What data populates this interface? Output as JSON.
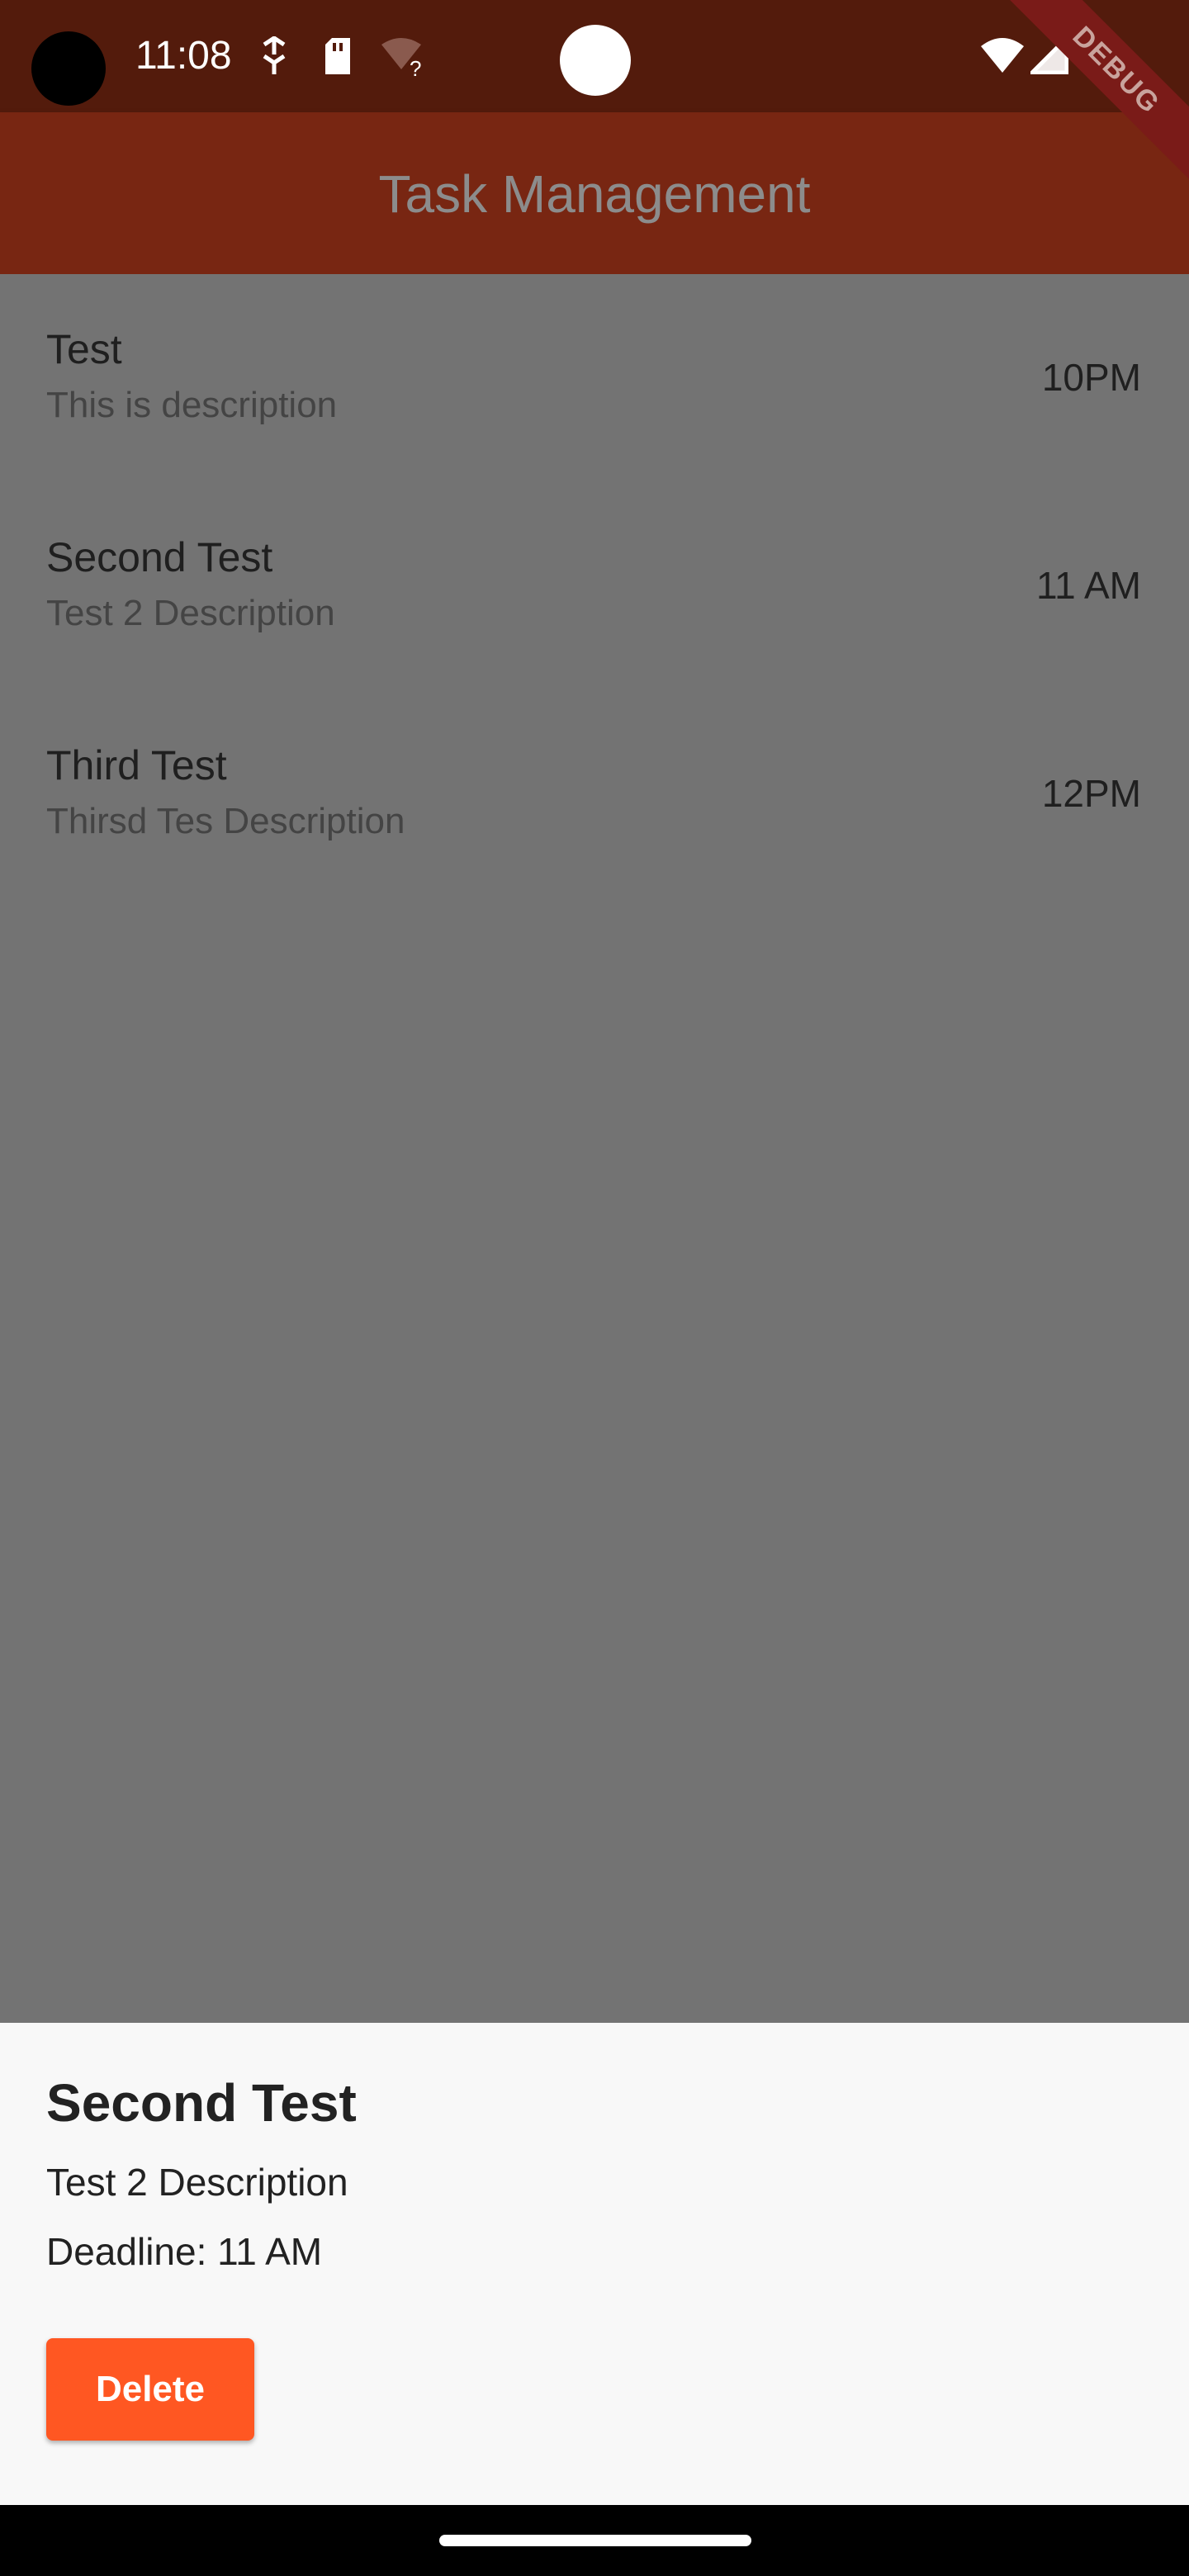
{
  "status_bar": {
    "time": "11:08",
    "icons": [
      "sync-icon",
      "sd-card-icon",
      "wifi-question-icon",
      "wifi-icon",
      "cell-signal-icon"
    ]
  },
  "app_bar": {
    "title": "Task Management"
  },
  "debug_banner": "DEBUG",
  "tasks": [
    {
      "title": "Test",
      "description": "This is description",
      "time": "10PM"
    },
    {
      "title": "Second Test",
      "description": "Test 2 Description",
      "time": "11 AM"
    },
    {
      "title": "Third Test",
      "description": "Thirsd Tes Description",
      "time": "12PM"
    }
  ],
  "bottom_sheet": {
    "title": "Second Test",
    "description": "Test 2 Description",
    "deadline": "Deadline: 11 AM",
    "delete_label": "Delete"
  },
  "colors": {
    "app_bar": "#782612",
    "status_bar": "#531b0c",
    "scrim_background": "#737373",
    "delete_button": "#ff5722",
    "sheet_background": "#f8f8f8"
  }
}
